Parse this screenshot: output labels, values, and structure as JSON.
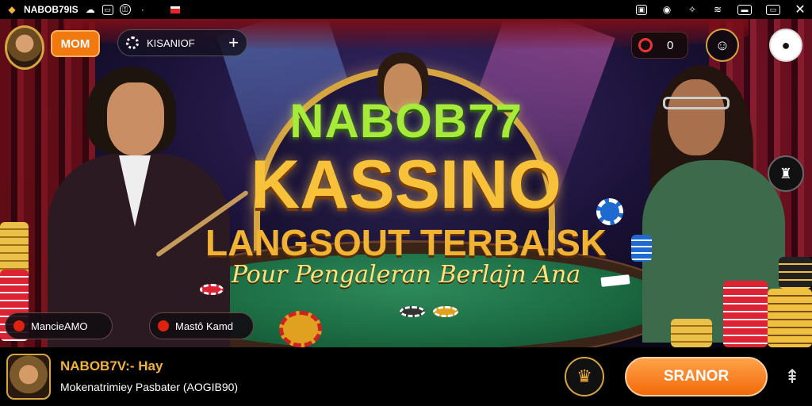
{
  "statusbar": {
    "app_label": "NABOB79IS",
    "icons": [
      "app-logo-icon",
      "cloud-icon",
      "message-icon",
      "vpn-icon",
      "dot-icon",
      "notification-badge-icon"
    ],
    "right_icons": [
      "lock-icon",
      "location-icon",
      "bell-icon",
      "wifi-icon",
      "screen-icon",
      "battery-icon",
      "close-icon"
    ]
  },
  "header": {
    "mom_label": "MOM",
    "search_label": "KISANIOF",
    "notif_count": "0"
  },
  "banner": {
    "line1": "NABOB77",
    "line2": "KASSINO",
    "line3": "LANGSOUT TERBAISK",
    "line4": "Pour Pengaleran Berlajn Ana"
  },
  "pills": {
    "left_label": "MancieAMO",
    "mid_label": "Mastô Kamd"
  },
  "bottombar": {
    "title": "NABOB7V:- Hay",
    "subtitle": "Mokenatrimiey Pasbater (AOGIB90)",
    "cta_label": "SRANOR"
  },
  "colors": {
    "accent_gold": "#f2b23a",
    "cta_orange": "#f26a0a",
    "title_green": "#a6ea3a"
  }
}
